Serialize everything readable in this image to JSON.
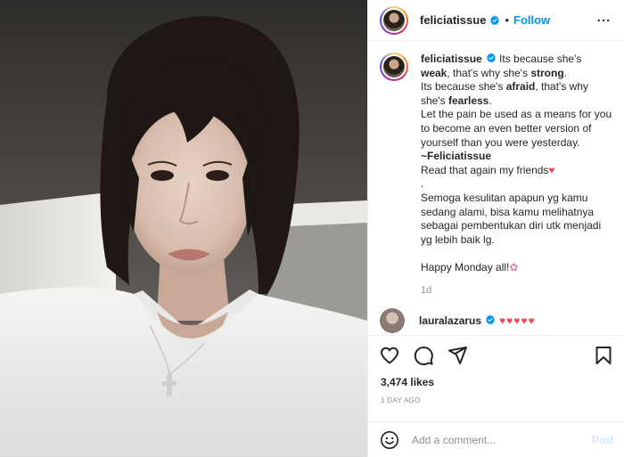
{
  "post": {
    "username": "feliciatissue",
    "follow_label": "Follow",
    "accent_color": "#0095f6",
    "caption": {
      "username": "feliciatissue",
      "line1a": "Its because she's",
      "line1b_bold": "weak",
      "line1c": ", that's why she's",
      "line1d_bold": "strong",
      "line1e": ".",
      "line2a": "Its because she's",
      "line2b_bold": "afraid",
      "line2c": ", that's why she's",
      "line2d_bold": "fearless",
      "line2e": ".",
      "line3": "Let the pain be used as a means for you to become an even better version of yourself than you were yesterday.",
      "signature": "~Feliciatissue",
      "line4": "Read that again my friends",
      "dot": ".",
      "line5": "Semoga kesulitan apapun yg kamu sedang alami, bisa kamu melihatnya sebagai pembentukan diri utk menjadi yg lebih baik lg.",
      "line6": "Happy Monday all!",
      "time": "1d"
    },
    "reply": {
      "username": "lauralazarus",
      "hearts": "♥♥♥♥♥"
    },
    "likes": "3,474 likes",
    "posted": "1 DAY AGO",
    "comment_placeholder": "Add a comment...",
    "post_label": "Post"
  },
  "icons": [
    "more-icon",
    "verified-icon",
    "heart-icon",
    "comment-icon",
    "share-icon",
    "save-icon",
    "emoji-icon"
  ]
}
